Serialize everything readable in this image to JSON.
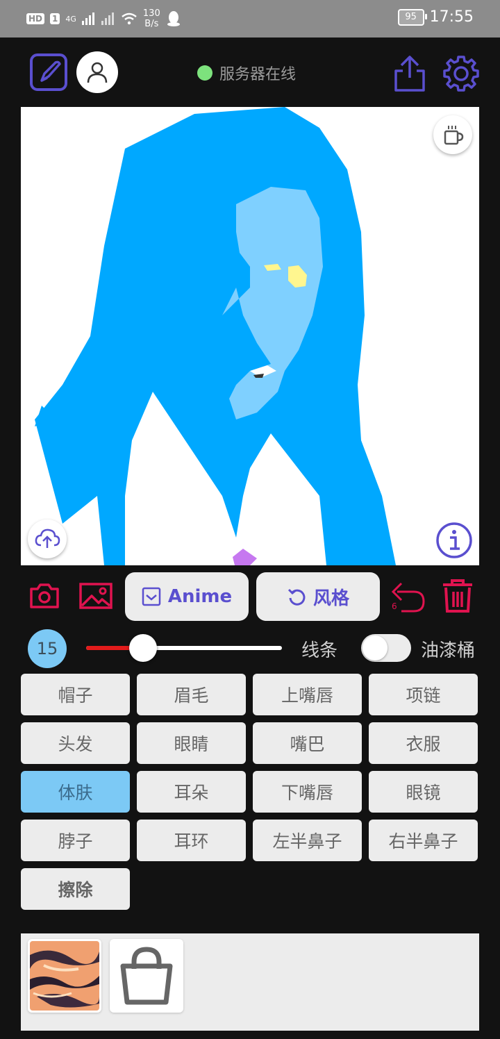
{
  "status_bar": {
    "hd_badge": "HD",
    "sim_badge": "1",
    "network": "4G",
    "speed_value": "130",
    "speed_unit": "B/s",
    "battery": "95",
    "time": "17:55"
  },
  "header": {
    "server_status": "服务器在线",
    "status_color": "#7de27d"
  },
  "toolbar": {
    "anime_label": "Anime",
    "style_label": "风格",
    "undo_count": "6"
  },
  "brush": {
    "size": "15",
    "size_fraction": 0.29,
    "line_label": "线条",
    "bucket_label": "油漆桶",
    "bucket_enabled": false
  },
  "labels": {
    "row1": [
      "帽子",
      "眉毛",
      "上嘴唇",
      "项链"
    ],
    "row2": [
      "头发",
      "眼睛",
      "嘴巴",
      "衣服"
    ],
    "row3": [
      "体肤",
      "耳朵",
      "下嘴唇",
      "眼镜"
    ],
    "row4": [
      "脖子",
      "耳环",
      "左半鼻子",
      "右半鼻子"
    ],
    "row5": [
      "擦除"
    ],
    "selected": "体肤"
  },
  "colors": {
    "accent": "#5a4fcf",
    "danger": "#e0134f",
    "hair": "#00a8ff",
    "skin": "#7fd0ff",
    "selected_chip": "#7cc9f5"
  },
  "icons": {
    "edit": "edit-brush-icon",
    "avatar": "user-icon",
    "share": "share-icon",
    "settings": "gear-icon",
    "coffee": "coffee-icon",
    "upload": "cloud-upload-icon",
    "info": "info-icon",
    "camera": "camera-icon",
    "gallery": "image-icon",
    "undo": "undo-icon",
    "delete": "trash-icon",
    "shop": "shopping-bag-icon"
  }
}
